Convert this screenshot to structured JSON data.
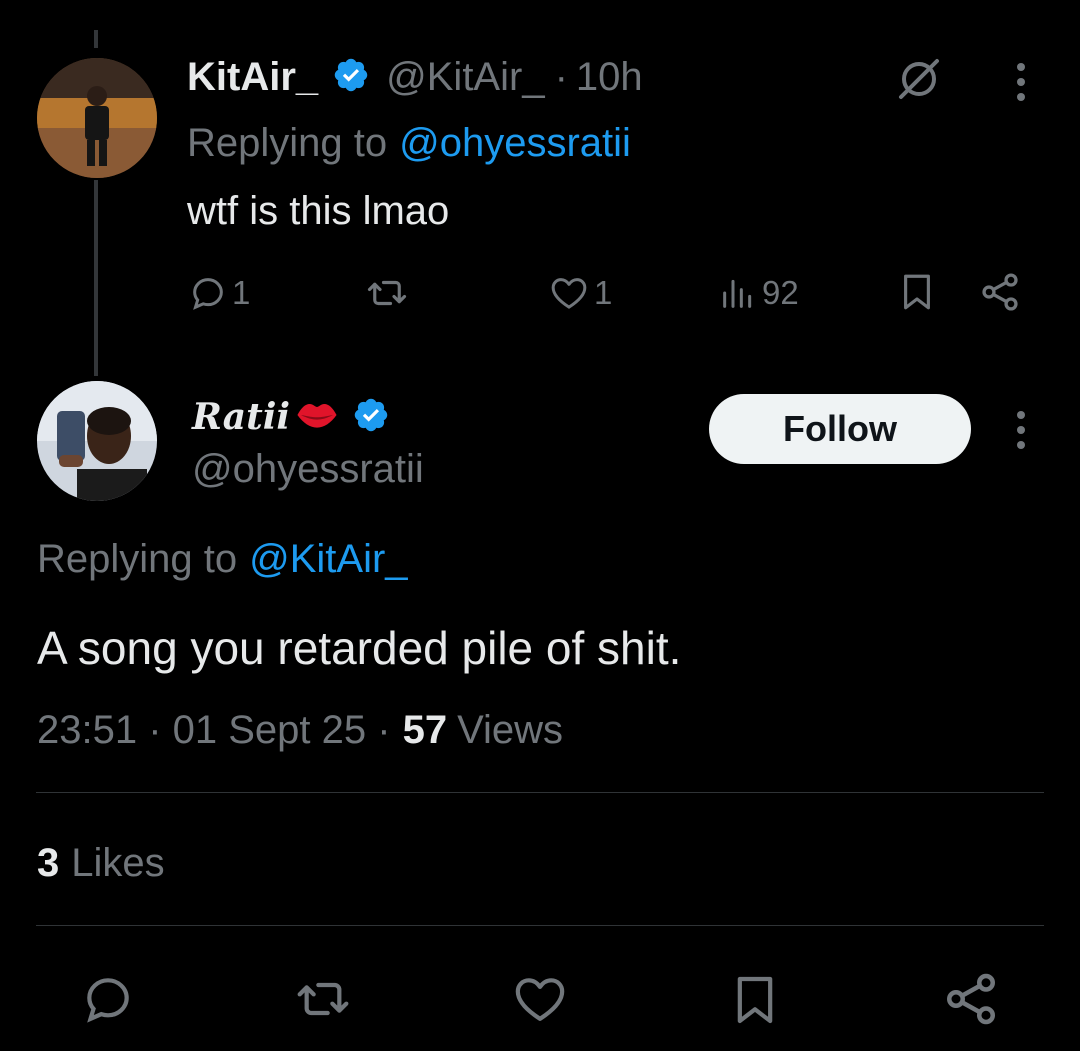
{
  "parent_tweet": {
    "author_name": "KitAir_",
    "handle": "@KitAir_",
    "time_separator": "·",
    "time": "10h",
    "replying_prefix": "Replying to",
    "replying_to": "@ohyessratii",
    "text": "wtf is this lmao",
    "reply_count": "1",
    "like_count": "1",
    "view_count": "92"
  },
  "main_tweet": {
    "author_name": "Ratii",
    "handle": "@ohyessratii",
    "follow_label": "Follow",
    "replying_prefix": "Replying to",
    "replying_to": "@KitAir_",
    "text": "A song you retarded pile of shit.",
    "timestamp": "23:51 · 01 Sept 25 ·",
    "views_count": "57",
    "views_label": "Views",
    "likes_count": "3",
    "likes_label": "Likes"
  },
  "icons": {
    "verified": "verified-badge-icon",
    "grok": "grok-icon",
    "more": "more-options-icon",
    "reply": "reply-icon",
    "retweet": "retweet-icon",
    "like": "like-icon",
    "views": "views-icon",
    "bookmark": "bookmark-icon",
    "share": "share-icon",
    "lips": "lips-emoji-icon"
  },
  "colors": {
    "background": "#000000",
    "text": "#e7e9ea",
    "muted": "#71767b",
    "link": "#1d9bf0",
    "divider": "#2f3336"
  }
}
